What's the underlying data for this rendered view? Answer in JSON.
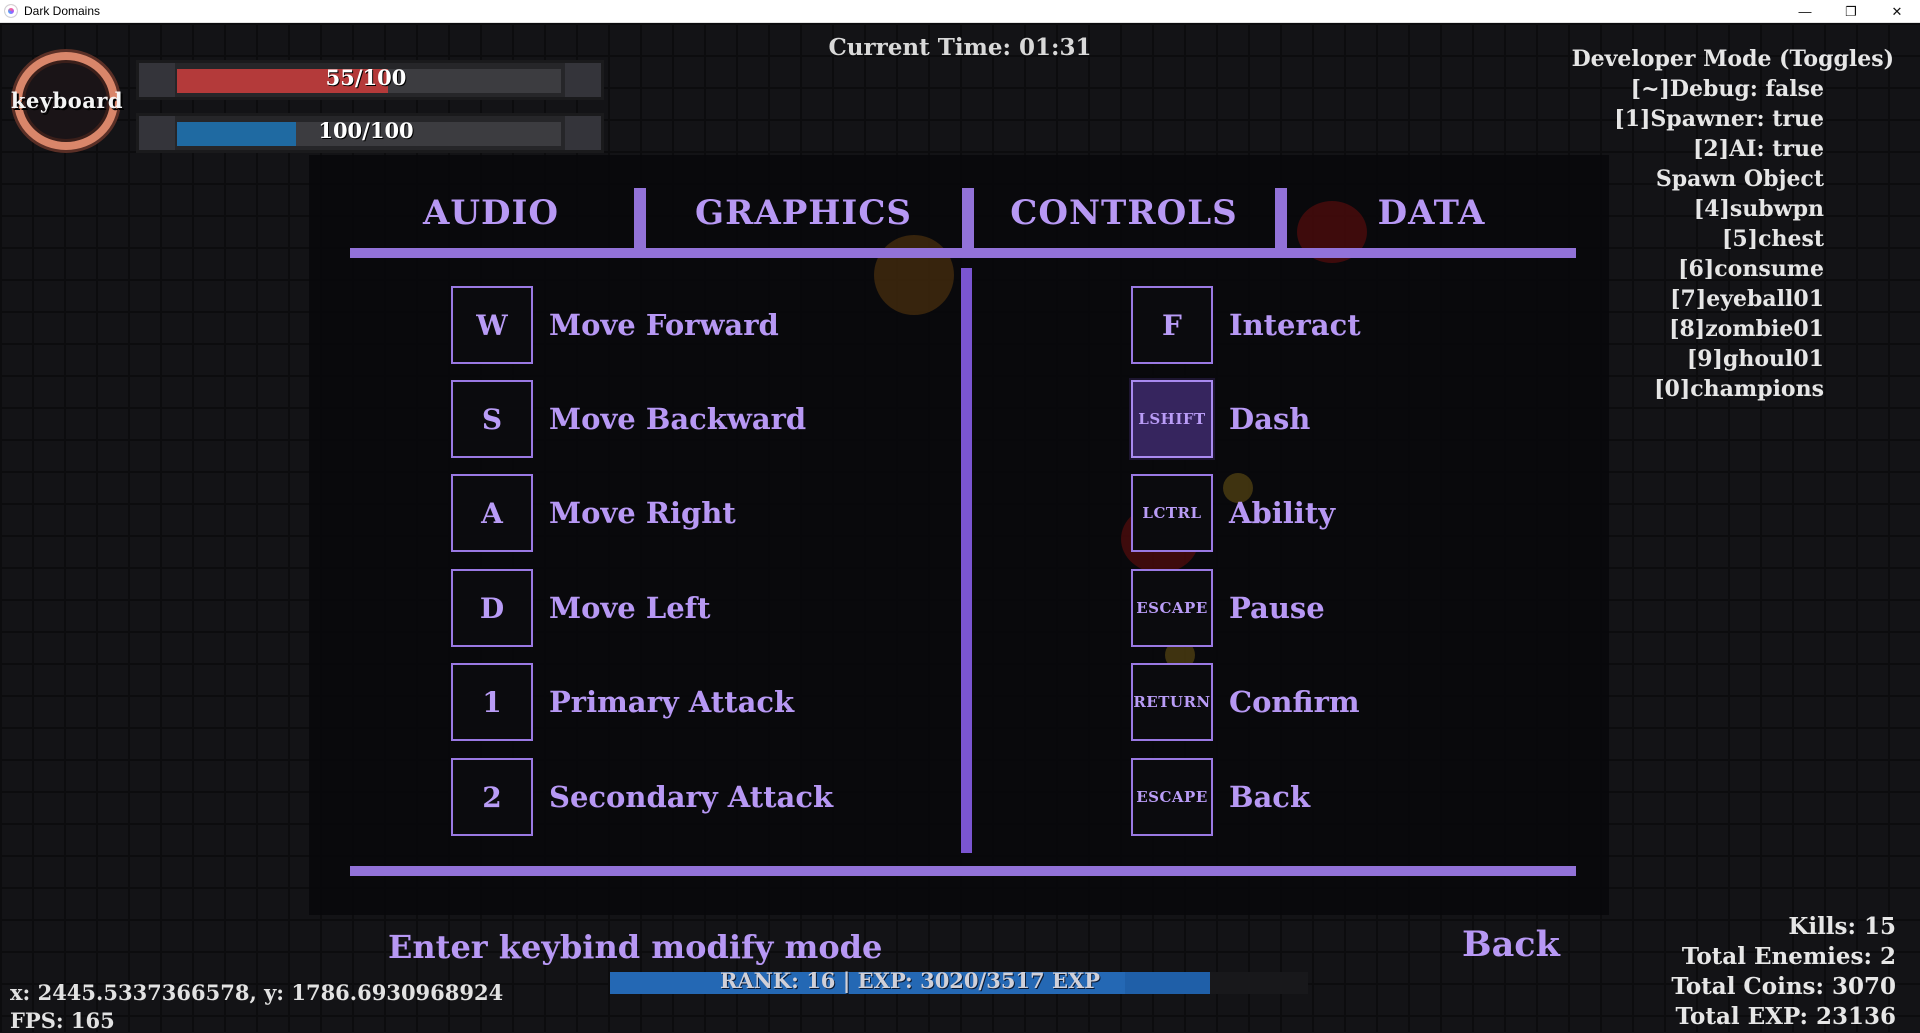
{
  "window": {
    "title": "Dark Domains",
    "controls": [
      "—",
      "❐",
      "✕"
    ]
  },
  "hud": {
    "portrait_label": "keyboard",
    "health": {
      "text": "55/100",
      "fraction": 0.55,
      "color": "#b43a3a"
    },
    "mana": {
      "text": "100/100",
      "fraction": 0.31,
      "color": "#1f6aa2"
    },
    "current_time": "Current Time: 01:31"
  },
  "dev": {
    "title": "Developer Mode (Toggles)",
    "lines": [
      "[~]Debug: false",
      "[1]Spawner: true",
      "[2]AI: true",
      "Spawn Object",
      "[4]subwpn",
      "[5]chest",
      "[6]consume",
      "[7]eyeball01",
      "[8]zombie01",
      "[9]ghoul01",
      "[0]champions"
    ]
  },
  "tabs": [
    "AUDIO",
    "GRAPHICS",
    "CONTROLS",
    "DATA"
  ],
  "bindings_left": [
    {
      "key": "W",
      "action": "Move Forward"
    },
    {
      "key": "S",
      "action": "Move Backward"
    },
    {
      "key": "A",
      "action": "Move Right"
    },
    {
      "key": "D",
      "action": "Move Left"
    },
    {
      "key": "1",
      "action": "Primary Attack"
    },
    {
      "key": "2",
      "action": "Secondary Attack"
    }
  ],
  "bindings_right": [
    {
      "key": "F",
      "action": "Interact"
    },
    {
      "key": "LSHIFT",
      "action": "Dash"
    },
    {
      "key": "LCTRL",
      "action": "Ability"
    },
    {
      "key": "ESCAPE",
      "action": "Pause"
    },
    {
      "key": "RETURN",
      "action": "Confirm"
    },
    {
      "key": "ESCAPE",
      "action": "Back"
    }
  ],
  "footer": {
    "keybind_mode": "Enter keybind modify mode",
    "back": "Back",
    "exp": "RANK: 16 | EXP: 3020/3517 EXP",
    "exp_fraction": 0.859,
    "coords": "x: 2445.5337366578, y: 1786.6930968924",
    "fps": "FPS: 165"
  },
  "stats": [
    "Kills: 15",
    "Total Enemies: 2",
    "Total Coins: 3070",
    "Total EXP: 23136"
  ]
}
